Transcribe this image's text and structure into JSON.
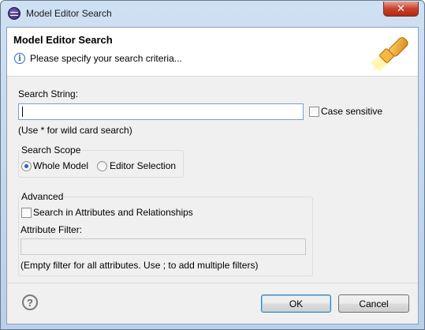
{
  "window": {
    "title": "Model Editor Search",
    "close_glyph": "✕"
  },
  "header": {
    "title": "Model Editor Search",
    "message": "Please specify your search criteria...",
    "info_glyph": "i"
  },
  "search": {
    "label": "Search String:",
    "value": "",
    "case_sensitive_label": "Case sensitive",
    "case_sensitive_checked": false,
    "hint": "(Use * for wild card search)"
  },
  "scope": {
    "title": "Search Scope",
    "options": [
      {
        "label": "Whole Model",
        "selected": true
      },
      {
        "label": "Editor Selection",
        "selected": false
      }
    ]
  },
  "advanced": {
    "title": "Advanced",
    "search_attributes_label": "Search in Attributes and Relationships",
    "search_attributes_checked": false,
    "filter_label": "Attribute Filter:",
    "filter_value": "",
    "filter_hint": "(Empty filter for all attributes. Use ; to add multiple filters)"
  },
  "footer": {
    "help_glyph": "?",
    "ok_label": "OK",
    "cancel_label": "Cancel"
  }
}
